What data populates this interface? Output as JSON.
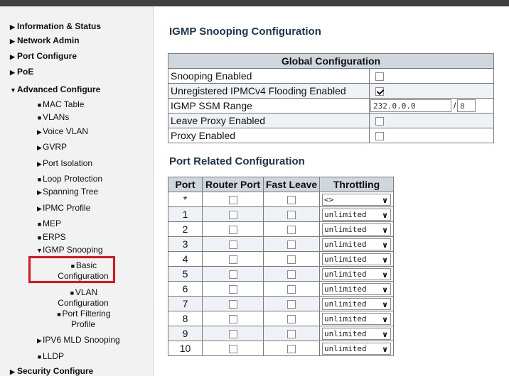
{
  "sidebar": {
    "items": [
      {
        "label": "Information & Status",
        "marker": "▶",
        "level": "top"
      },
      {
        "label": "Network Admin",
        "marker": "▶",
        "level": "top"
      },
      {
        "label": "Port Configure",
        "marker": "▶",
        "level": "top"
      },
      {
        "label": "PoE",
        "marker": "▶",
        "level": "top"
      },
      {
        "label": "Advanced Configure",
        "marker": "▼",
        "level": "top"
      },
      {
        "label": "MAC Table",
        "marker": "■"
      },
      {
        "label": "VLANs",
        "marker": "■"
      },
      {
        "label": "Voice VLAN",
        "marker": "▶"
      },
      {
        "label": "GVRP",
        "marker": "▶"
      },
      {
        "label": "Port Isolation",
        "marker": "▶"
      },
      {
        "label": "Loop Protection",
        "marker": "■"
      },
      {
        "label": "Spanning Tree",
        "marker": "▶"
      },
      {
        "label": "IPMC Profile",
        "marker": "▶"
      },
      {
        "label": "MEP",
        "marker": "■"
      },
      {
        "label": "ERPS",
        "marker": "■"
      },
      {
        "label": "IGMP Snooping",
        "marker": "▼"
      },
      {
        "label": "Basic Configuration",
        "marker": "■",
        "selected": true
      },
      {
        "label": "VLAN Configuration",
        "marker": "■"
      },
      {
        "label": "Port Filtering Profile",
        "marker": "■"
      },
      {
        "label": "IPV6 MLD Snooping",
        "marker": "▶"
      },
      {
        "label": "LLDP",
        "marker": "■"
      },
      {
        "label": "Security Configure",
        "marker": "▶",
        "level": "top"
      }
    ]
  },
  "main": {
    "title": "IGMP Snooping Configuration",
    "global": {
      "header": "Global Configuration",
      "rows": [
        {
          "label": "Snooping Enabled",
          "checked": false
        },
        {
          "label": "Unregistered IPMCv4 Flooding Enabled",
          "checked": true
        },
        {
          "label": "IGMP SSM Range",
          "ip": "232.0.0.0",
          "mask": "8"
        },
        {
          "label": "Leave Proxy Enabled",
          "checked": false
        },
        {
          "label": "Proxy Enabled",
          "checked": false
        }
      ]
    },
    "port_section_title": "Port Related Configuration",
    "port_table": {
      "headers": [
        "Port",
        "Router Port",
        "Fast Leave",
        "Throttling"
      ],
      "rows": [
        {
          "port": "*",
          "throttling": "<>"
        },
        {
          "port": "1",
          "throttling": "unlimited"
        },
        {
          "port": "2",
          "throttling": "unlimited"
        },
        {
          "port": "3",
          "throttling": "unlimited"
        },
        {
          "port": "4",
          "throttling": "unlimited"
        },
        {
          "port": "5",
          "throttling": "unlimited"
        },
        {
          "port": "6",
          "throttling": "unlimited"
        },
        {
          "port": "7",
          "throttling": "unlimited"
        },
        {
          "port": "8",
          "throttling": "unlimited"
        },
        {
          "port": "9",
          "throttling": "unlimited"
        },
        {
          "port": "10",
          "throttling": "unlimited"
        }
      ]
    }
  },
  "colors": {
    "header_bg": "#cfd6dd",
    "row_alt_bg": "#eef2f6",
    "highlight": "#e3131b",
    "title": "#1a3552"
  },
  "icons": {
    "collapsed": "triangle-right-icon",
    "expanded": "triangle-down-icon",
    "leaf": "square-bullet-icon",
    "dropdown": "chevron-down-icon"
  }
}
